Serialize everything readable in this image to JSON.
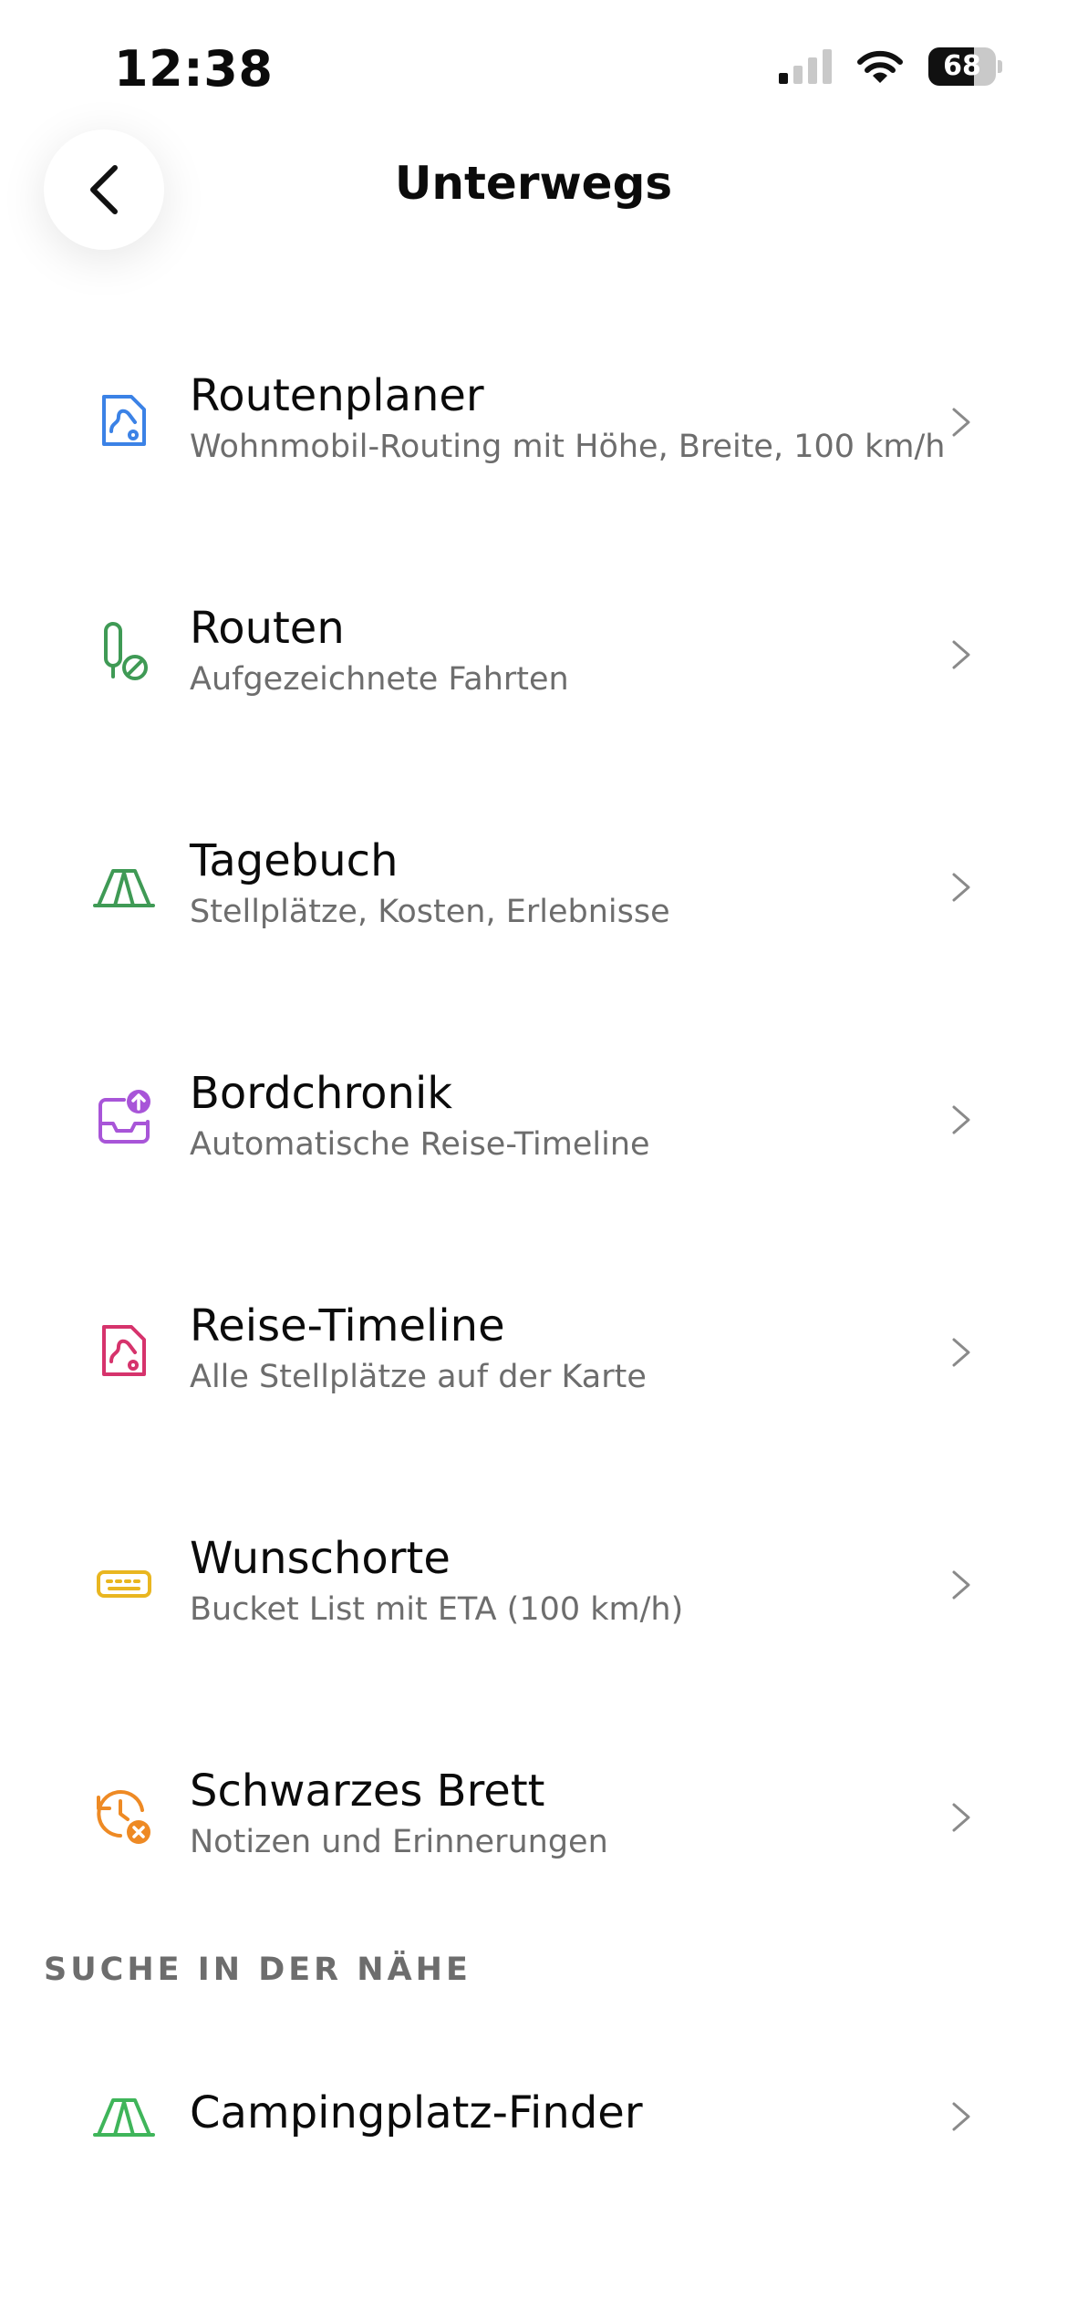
{
  "status": {
    "time": "12:38",
    "battery": "68",
    "battery_level": 0.68
  },
  "header": {
    "title": "Unterwegs"
  },
  "menu": {
    "items": [
      {
        "title": "Routenplaner",
        "subtitle": "Wohnmobil-Routing mit Höhe, Breite, 100 km/h",
        "icon": "route-planner-icon",
        "color": "#3b82e6"
      },
      {
        "title": "Routen",
        "subtitle": "Aufgezeichnete Fahrten",
        "icon": "routes-icon",
        "color": "#3f9a55"
      },
      {
        "title": "Tagebuch",
        "subtitle": "Stellplätze, Kosten, Erlebnisse",
        "icon": "tent-icon",
        "color": "#3f9a55"
      },
      {
        "title": "Bordchronik",
        "subtitle": "Automatische Reise-Timeline",
        "icon": "inbox-upload-icon",
        "color": "#a855d8"
      },
      {
        "title": "Reise-Timeline",
        "subtitle": "Alle Stellplätze auf der Karte",
        "icon": "map-pin-icon",
        "color": "#d6336c"
      },
      {
        "title": "Wunschorte",
        "subtitle": "Bucket List mit ETA (100 km/h)",
        "icon": "ticket-icon",
        "color": "#e9b620"
      },
      {
        "title": "Schwarzes Brett",
        "subtitle": "Notizen und Erinnerungen",
        "icon": "clock-alert-icon",
        "color": "#ee8a24"
      }
    ]
  },
  "nearby": {
    "section_title": "SUCHE IN DER NÄHE",
    "items": [
      {
        "title": "Campingplatz-Finder",
        "icon": "tent-icon",
        "color": "#3fb55a"
      }
    ]
  }
}
